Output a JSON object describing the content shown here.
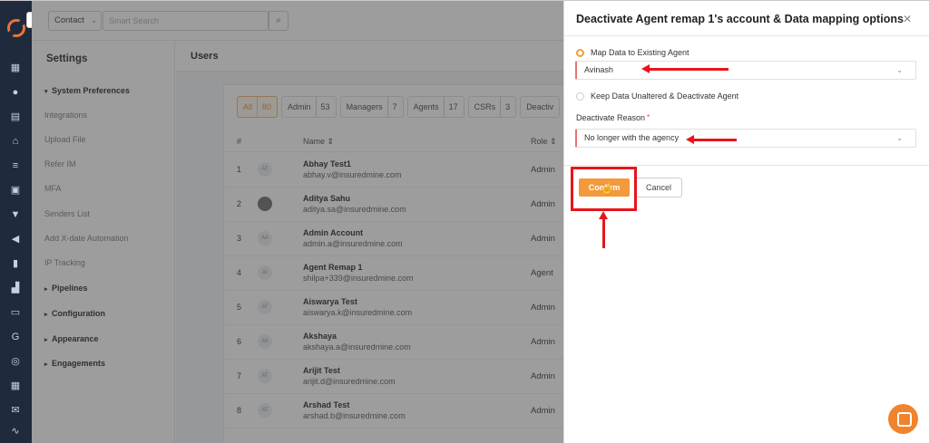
{
  "topbar": {
    "context_select": "Contact",
    "search_placeholder": "Smart Search"
  },
  "settings": {
    "title": "Settings",
    "items": [
      {
        "label": "System Preferences",
        "kind": "group-open"
      },
      {
        "label": "Integrations",
        "kind": "sub"
      },
      {
        "label": "Upload File",
        "kind": "sub"
      },
      {
        "label": "Refer IM",
        "kind": "sub"
      },
      {
        "label": "MFA",
        "kind": "sub"
      },
      {
        "label": "Senders List",
        "kind": "sub"
      },
      {
        "label": "Add X-date Automation",
        "kind": "sub"
      },
      {
        "label": "IP Tracking",
        "kind": "sub"
      },
      {
        "label": "Pipelines",
        "kind": "group"
      },
      {
        "label": "Configuration",
        "kind": "group"
      },
      {
        "label": "Appearance",
        "kind": "group"
      },
      {
        "label": "Engagements",
        "kind": "group"
      }
    ]
  },
  "users": {
    "header": "Users",
    "filters": [
      {
        "label": "All",
        "count": "80",
        "active": true
      },
      {
        "label": "Admin",
        "count": "53"
      },
      {
        "label": "Managers",
        "count": "7"
      },
      {
        "label": "Agents",
        "count": "17"
      },
      {
        "label": "CSRs",
        "count": "3"
      },
      {
        "label": "Deactiv",
        "count": ""
      }
    ],
    "columns": {
      "num": "#",
      "name": "Name ⇕",
      "role": "Role ⇕"
    },
    "rows": [
      {
        "num": "1",
        "avatar": "AT",
        "name": "Abhay Test1",
        "email": "abhay.v@insuredmine.com",
        "role": "Admin"
      },
      {
        "num": "2",
        "avatar": "",
        "name": "Aditya Sahu",
        "email": "aditya.sa@insuredmine.com",
        "role": "Admin"
      },
      {
        "num": "3",
        "avatar": "AA",
        "name": "Admin Account",
        "email": "admin.a@insuredmine.com",
        "role": "Admin"
      },
      {
        "num": "4",
        "avatar": "AI",
        "name": "Agent Remap 1",
        "email": "shilpa+339@insuredmine.com",
        "role": "Agent"
      },
      {
        "num": "5",
        "avatar": "AT",
        "name": "Aiswarya Test",
        "email": "aiswarya.k@insuredmine.com",
        "role": "Admin"
      },
      {
        "num": "6",
        "avatar": "AK",
        "name": "Akshaya",
        "email": "akshaya.a@insuredmine.com",
        "role": "Admin"
      },
      {
        "num": "7",
        "avatar": "AT",
        "name": "Arijit Test",
        "email": "arijit.d@insuredmine.com",
        "role": "Admin"
      },
      {
        "num": "8",
        "avatar": "AT",
        "name": "Arshad Test",
        "email": "arshad.b@insuredmine.com",
        "role": "Admin"
      }
    ]
  },
  "drawer": {
    "title": "Deactivate Agent remap 1's account & Data mapping options",
    "option_map": "Map Data to Existing Agent",
    "agent_value": "Avinash",
    "option_keep": "Keep Data Unaltered & Deactivate Agent",
    "reason_label": "Deactivate Reason",
    "reason_required_mark": "*",
    "reason_value": "No longer with the agency",
    "confirm_label": "Confirm",
    "cancel_label": "Cancel"
  },
  "colors": {
    "accent": "#f29a3c",
    "sidebar": "#1f2a3c",
    "annotation": "#e8141b"
  }
}
